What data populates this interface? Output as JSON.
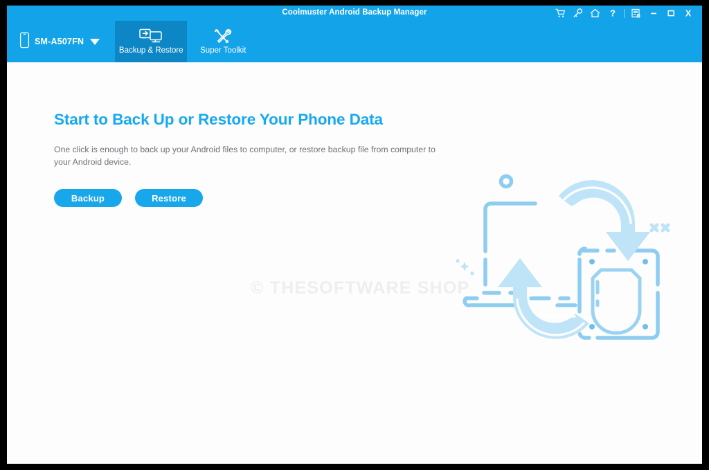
{
  "window": {
    "title": "Coolmuster Android Backup Manager",
    "accent_blue": "#13a3e8",
    "active_tab_blue": "#0d86c6",
    "headline_blue": "#17a9f0",
    "button_blue": "#18a7ea",
    "frame_color": "#000000",
    "content_background": "#fdfdfd"
  },
  "titlebar": {
    "icons": [
      {
        "name": "cart-icon",
        "label": "Cart"
      },
      {
        "name": "key-icon",
        "label": "Key"
      },
      {
        "name": "home-icon",
        "label": "Home"
      },
      {
        "name": "help-icon",
        "label": "?"
      },
      {
        "name": "register-icon",
        "label": "Register"
      },
      {
        "name": "minimize-icon",
        "label": "Minimize"
      },
      {
        "name": "maximize-icon",
        "label": "Maximize"
      },
      {
        "name": "close-icon",
        "label": "X"
      }
    ]
  },
  "navbar": {
    "device": {
      "name": "SM-A507FN",
      "icon": "phone-icon",
      "dropdown_icon": "chevron-down-icon"
    },
    "tabs": [
      {
        "label": "Backup & Restore",
        "icon": "backup-restore-icon",
        "active": true
      },
      {
        "label": "Super Toolkit",
        "icon": "toolkit-icon",
        "active": false
      }
    ]
  },
  "main": {
    "headline": "Start to Back Up or Restore Your Phone Data",
    "description": "One click is enough to back up your Android files to computer, or restore backup file from computer to your Android device.",
    "buttons": [
      {
        "label": "Backup",
        "name": "backup-button"
      },
      {
        "label": "Restore",
        "name": "restore-button"
      }
    ],
    "watermark": "© THESOFTWARE SHOP",
    "illustration": {
      "name": "backup-restore-illustration",
      "elements": [
        "laptop-outline",
        "phone-outline",
        "down-arrow",
        "up-arrow"
      ]
    }
  }
}
